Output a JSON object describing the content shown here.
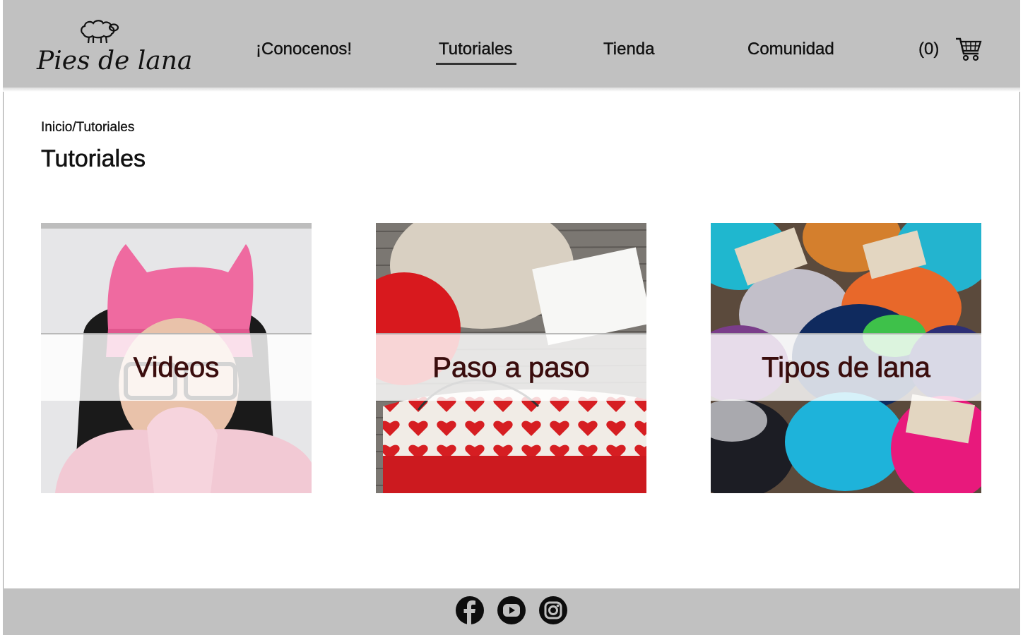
{
  "brand": {
    "name": "Pies de lana",
    "logo_icon": "sheep-icon"
  },
  "nav": {
    "items": [
      {
        "label": "¡Conocenos!",
        "active": false
      },
      {
        "label": "Tutoriales",
        "active": true
      },
      {
        "label": "Tienda",
        "active": false
      },
      {
        "label": "Comunidad",
        "active": false
      }
    ],
    "cart_count": "(0)",
    "cart_icon": "shopping-cart-icon"
  },
  "breadcrumb": "Inicio/Tutoriales",
  "page_title": "Tutoriales",
  "cards": [
    {
      "label": "Videos"
    },
    {
      "label": "Paso a paso"
    },
    {
      "label": "Tipos de lana"
    }
  ],
  "footer": {
    "social": [
      "facebook-icon",
      "youtube-icon",
      "instagram-icon"
    ]
  },
  "colors": {
    "header_bg": "#c1c1c1",
    "card_label": "#3a0d0d"
  }
}
